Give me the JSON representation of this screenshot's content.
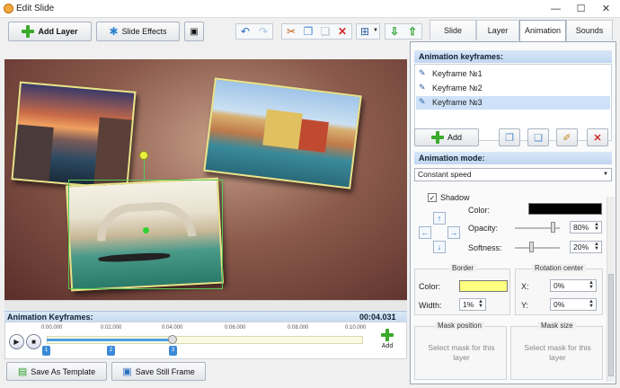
{
  "window": {
    "title": "Edit Slide",
    "minimize": "—",
    "maximize": "☐",
    "close": "✕"
  },
  "toolbar": {
    "add_layer": "Add Layer",
    "slide_effects": "Slide Effects"
  },
  "tabs": [
    {
      "label": "Slide"
    },
    {
      "label": "Layer"
    },
    {
      "label": "Animation"
    },
    {
      "label": "Sounds"
    }
  ],
  "panel": {
    "keyframes_header": "Animation keyframes:",
    "keyframes": [
      "Keyframe №1",
      "Keyframe №2",
      "Keyframe №3"
    ],
    "add_label": "Add",
    "mode_header": "Animation mode:",
    "mode_value": "Constant speed",
    "shadow_label": "Shadow",
    "color_label": "Color:",
    "opacity_label": "Opacity:",
    "opacity_value": "80%",
    "softness_label": "Softness:",
    "softness_value": "20%",
    "border_group": "Border",
    "border_color_label": "Color:",
    "border_width_label": "Width:",
    "border_width_value": "1%",
    "rotation_group": "Rotation center",
    "rot_x_label": "X:",
    "rot_x_value": "0%",
    "rot_y_label": "Y:",
    "rot_y_value": "0%",
    "mask_position_group": "Mask position",
    "mask_size_group": "Mask size",
    "mask_position_text": "Select mask for this layer",
    "mask_size_text": "Select mask for this layer",
    "colors": {
      "shadow": "#000000",
      "border": "#ffff80"
    }
  },
  "timeline": {
    "label": "Animation Keyframes:",
    "current": "00:04.031",
    "total": "00:10.000",
    "ticks": [
      "0:00.000",
      "0:02.000",
      "0:04.000",
      "0:06.000",
      "0:08.000",
      "0:10.000"
    ],
    "markers": [
      "1",
      "2",
      "3"
    ],
    "add_label": "Add"
  },
  "footer": {
    "save_template": "Save As Template",
    "save_frame": "Save Still Frame"
  }
}
